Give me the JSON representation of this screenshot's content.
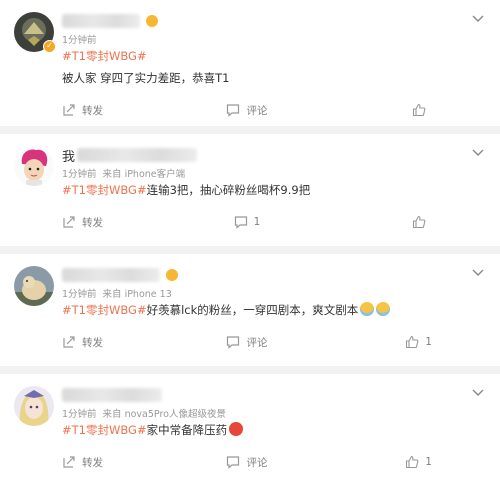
{
  "posts": [
    {
      "time": "1分钟前",
      "source": "",
      "tag": "#T1零封WBG#",
      "text": "被人家 穿四了实力差距，恭喜T1",
      "repost_label": "转发",
      "comment_label": "评论",
      "like_count": "",
      "avatar": "badge-avatar",
      "verified": true
    },
    {
      "name_prefix": "我",
      "time": "1分钟前",
      "source": "来自 iPhone客户端",
      "tag": "#T1零封WBG#",
      "text": "连输3把，抽心碎粉丝喝杯9.9把",
      "repost_label": "转发",
      "comment_count": "1",
      "like_count": ""
    },
    {
      "name_prefix": "",
      "time": "1分钟前",
      "source": "来自 iPhone 13",
      "tag": "#T1零封WBG#",
      "text": "好羡慕lck的粉丝，一穿四剧本，爽文剧本",
      "repost_label": "转发",
      "comment_label": "评论",
      "like_count": "1"
    },
    {
      "name_prefix": "",
      "time": "1分钟前",
      "source": "来自 nova5Pro人像超级夜景",
      "tag": "#T1零封WBG#",
      "text": "家中常备降压药",
      "repost_label": "转发",
      "comment_label": "评论",
      "like_count": "1"
    }
  ],
  "icons": {
    "more": "chevron-down-icon",
    "repost": "repost-icon",
    "comment": "comment-icon",
    "like": "like-icon"
  },
  "colors": {
    "tag": "#eb7350",
    "meta": "#999999",
    "background": "#f2f2f2"
  }
}
